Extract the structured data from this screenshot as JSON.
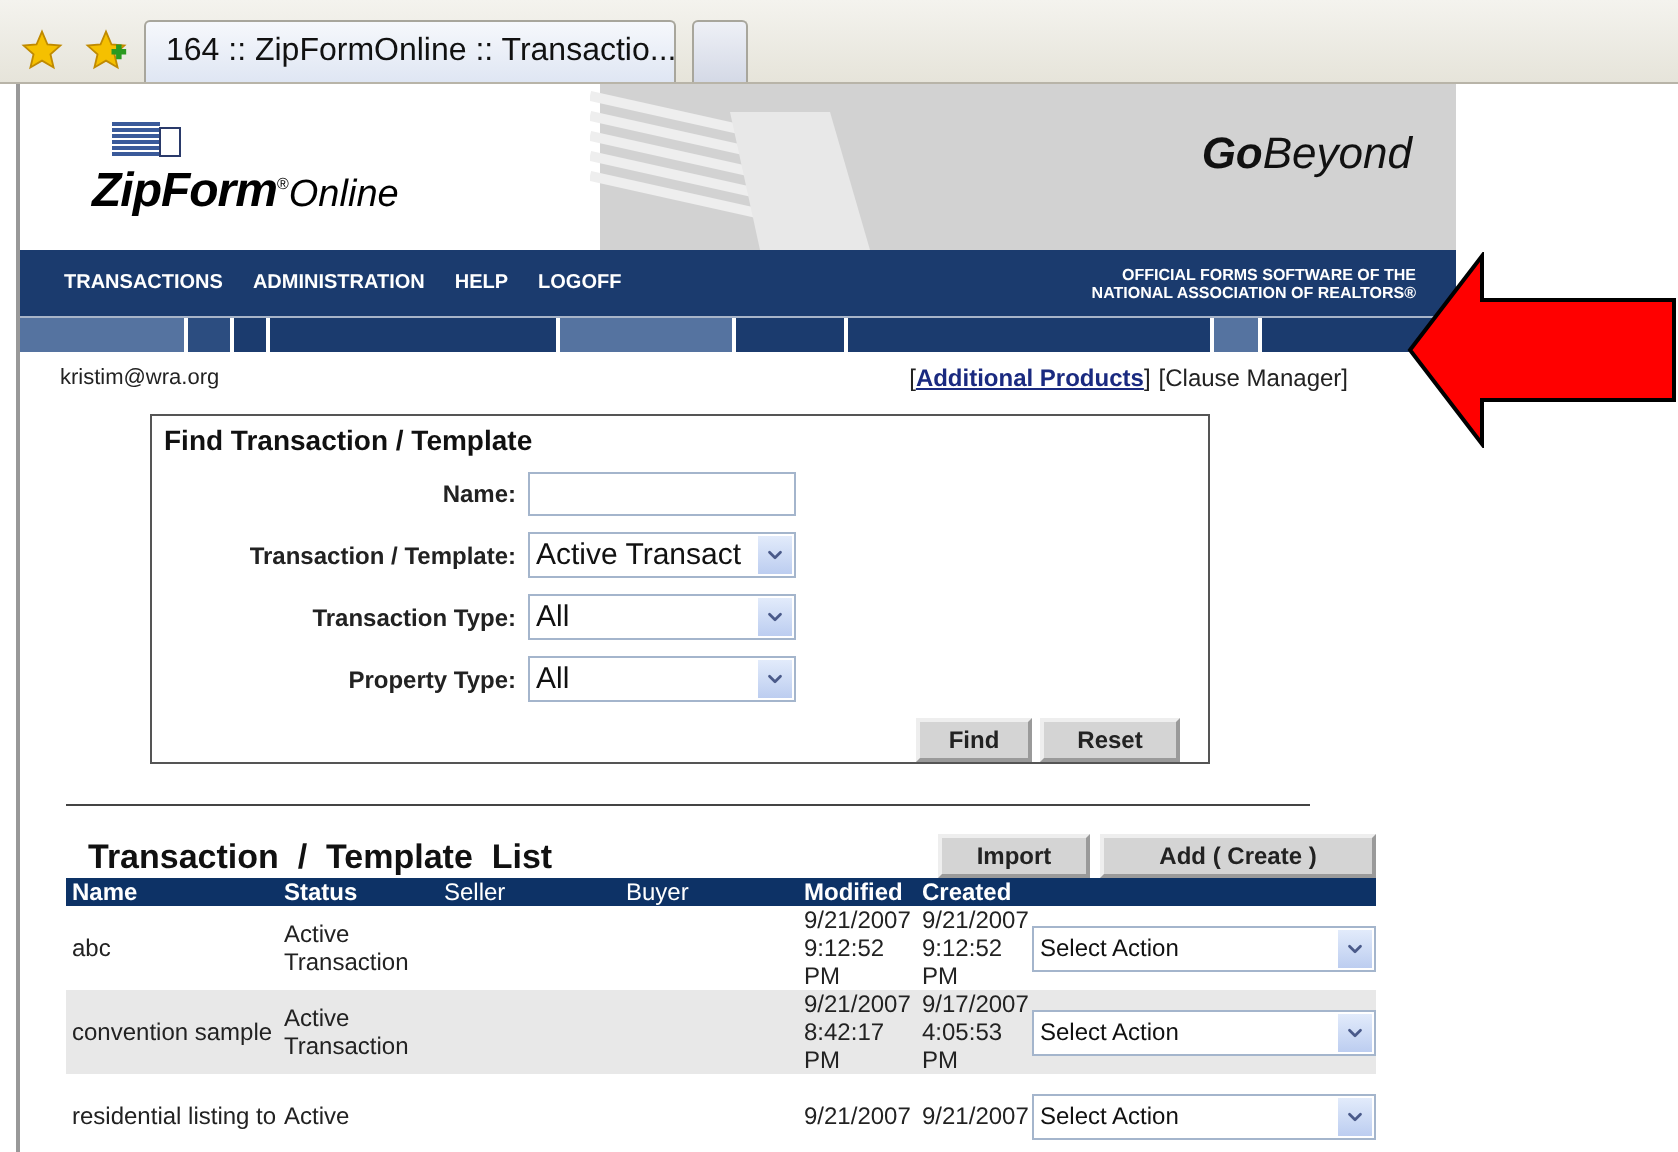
{
  "browser": {
    "tabs": [
      {
        "title": "164 :: ZipFormOnline :: Transactio...",
        "selected": true
      },
      {
        "selected": false
      }
    ]
  },
  "header": {
    "logo": {
      "brand": "ZipForm",
      "mark": "®",
      "suffix": "Online"
    },
    "tagline": "**Go**Beyond"
  },
  "nav": {
    "items": [
      "TRANSACTIONS",
      "ADMINISTRATION",
      "HELP",
      "LOGOFF"
    ],
    "official": [
      "OFFICIAL FORMS SOFTWARE OF THE",
      "NATIONAL ASSOCIATION OF REALTORS®"
    ]
  },
  "user_email": "kristim@wra.org",
  "links": [
    {
      "before": "[",
      "label": "Additional Products",
      "after": "]",
      "kind": "link"
    },
    {
      "label": "[Clause Manager]",
      "kind": "plain"
    }
  ],
  "find": {
    "title": "Find Transaction / Template",
    "fields": [
      {
        "label": "Name:",
        "kind": "text"
      },
      {
        "label": "Transaction / Template:",
        "kind": "select",
        "value": "Active Transact"
      },
      {
        "label": "Transaction Type:",
        "kind": "select",
        "value": "All"
      },
      {
        "label": "Property Type:",
        "kind": "select",
        "value": "All"
      }
    ],
    "buttons": [
      "Find",
      "Reset"
    ]
  },
  "list": {
    "title": "Transaction  /  Template  List",
    "buttons": [
      "Import",
      "Add ( Create )"
    ],
    "columns": [
      {
        "label": "Name",
        "bold": true
      },
      {
        "label": "Status",
        "bold": true
      },
      {
        "label": "Seller",
        "bold": false
      },
      {
        "label": "Buyer",
        "bold": false
      },
      {
        "label": "Modified",
        "bold": true
      },
      {
        "label": "Created",
        "bold": true
      }
    ],
    "rows": [
      {
        "name": "abc",
        "status": "Active Transaction",
        "modified": "9/21/2007 9:12:52 PM",
        "created": "9/21/2007 9:12:52 PM",
        "action": "Select Action"
      },
      {
        "name": "convention sample",
        "status": "Active Transaction",
        "modified": "9/21/2007 8:42:17 PM",
        "created": "9/17/2007 4:05:53 PM",
        "action": "Select Action"
      },
      {
        "name": "residential listing to",
        "status": "Active",
        "modified": "9/21/2007",
        "created": "9/21/2007",
        "action": "Select Action"
      }
    ]
  }
}
